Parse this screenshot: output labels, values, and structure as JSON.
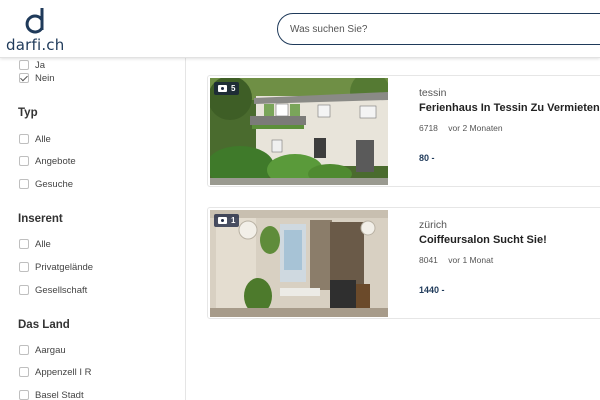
{
  "header": {
    "logo_text": "darfi.ch",
    "search_placeholder": "Was suchen Sie?"
  },
  "sidebar": {
    "top_options": [
      {
        "label": "Ja",
        "checked": false
      },
      {
        "label": "Nein",
        "checked": true
      }
    ],
    "sections": [
      {
        "title": "Typ",
        "options": [
          "Alle",
          "Angebote",
          "Gesuche"
        ]
      },
      {
        "title": "Inserent",
        "options": [
          "Alle",
          "Privatgelände",
          "Gesellschaft"
        ]
      },
      {
        "title": "Das Land",
        "options": [
          "Aargau",
          "Appenzell I R",
          "Basel Stadt"
        ]
      }
    ]
  },
  "listings": [
    {
      "photo_count": "5",
      "location": "tessin",
      "title": "Ferienhaus In Tessin Zu Vermieten",
      "postcode": "6718",
      "age": "vor 2 Monaten",
      "price": "80 -"
    },
    {
      "photo_count": "1",
      "location": "zürich",
      "title": "Coiffeursalon Sucht Sie!",
      "postcode": "8041",
      "age": "vor 1 Monat",
      "price": "1440 -"
    }
  ],
  "colors": {
    "brand": "#1f3a5a",
    "border": "#e6e6e6"
  }
}
